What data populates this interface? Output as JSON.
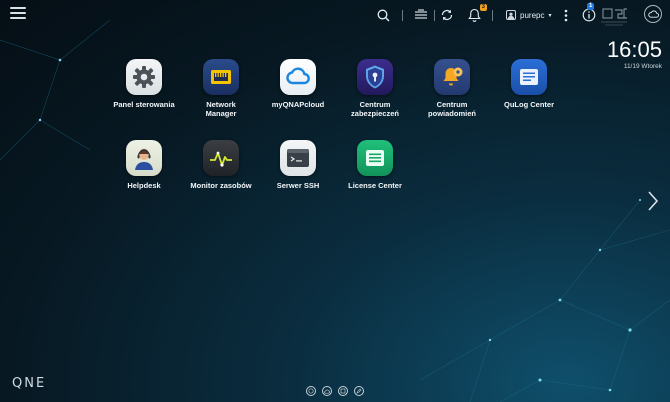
{
  "topbar": {
    "user_name": "purepc",
    "notif_badge": "3",
    "info_badge": "1"
  },
  "icons": {
    "menu": "hamburger-icon",
    "search": "search-icon",
    "tasks": "stack-icon",
    "sync": "sync-icon",
    "notifications": "bell-icon",
    "user": "user-icon",
    "more": "more-vertical-icon",
    "info": "info-icon",
    "cloud": "cloud-icon"
  },
  "clock": {
    "time": "16:05",
    "date": "11/19 Wtorek"
  },
  "apps": [
    {
      "label": "Panel sterowania"
    },
    {
      "label": "Network Manager"
    },
    {
      "label": "myQNAPcloud"
    },
    {
      "label": "Centrum zabezpieczeń"
    },
    {
      "label": "Centrum powiadomień"
    },
    {
      "label": "QuLog Center"
    },
    {
      "label": "Helpdesk"
    },
    {
      "label": "Monitor zasobów"
    },
    {
      "label": "Serwer SSH"
    },
    {
      "label": "License Center"
    }
  ],
  "footer": {
    "logo": "QNE"
  }
}
